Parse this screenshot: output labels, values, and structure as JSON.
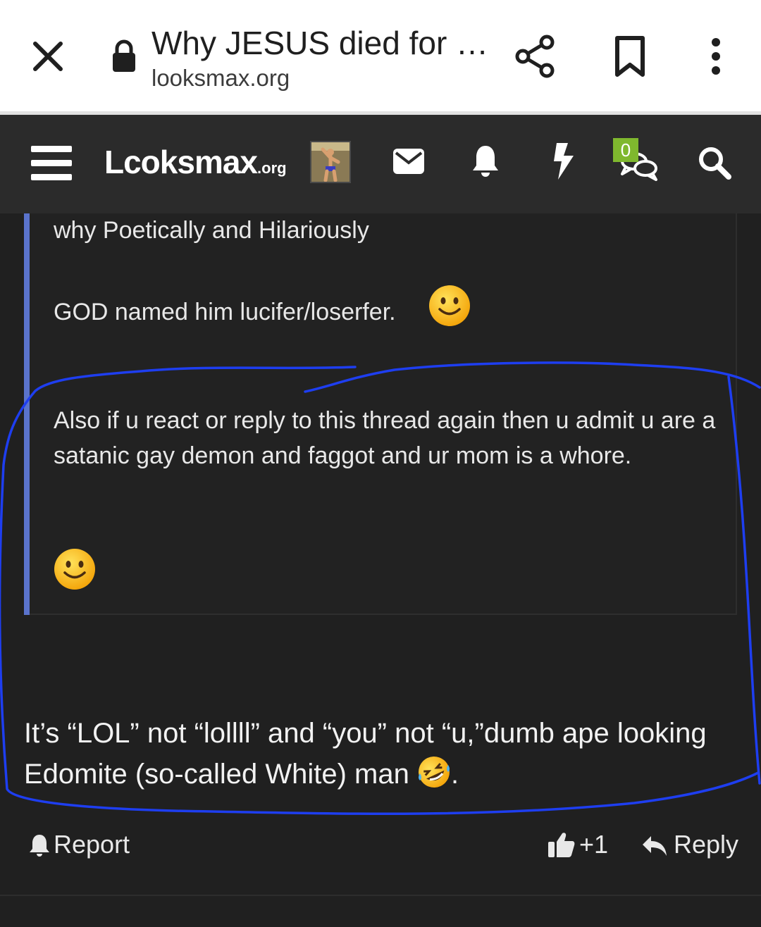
{
  "browser": {
    "title": "Why JESUS died for …",
    "url": "looksmax.org",
    "icons": [
      "close-icon",
      "lock-icon",
      "share-icon",
      "bookmark-icon",
      "more-vert-icon"
    ]
  },
  "nav": {
    "logo_main": "Lcoksmax",
    "logo_tld": ".org",
    "conversations_badge": "0",
    "icons": [
      "menu-icon",
      "inbox-icon",
      "bell-icon",
      "bolt-icon",
      "conversations-icon",
      "search-icon"
    ]
  },
  "quote": {
    "line1": "why Poetically and Hilariously",
    "line2": "GOD named him lucifer/loserfer.",
    "line3": "Also if u react or reply to this thread again then u admit u are a satanic gay demon and faggot and ur mom is a whore."
  },
  "post": {
    "text": "It’s “LOL” not “lollll” and “you” not “u,”dumb ape looking Edomite (so-called White) man",
    "trailing": "."
  },
  "actions": {
    "report": "Report",
    "reaction_count": "+1",
    "reply": "Reply"
  },
  "colors": {
    "background": "#202020",
    "nav_bar": "#2b2b2b",
    "quote_accent": "#5a73cc",
    "badge": "#7fb82e",
    "annotation_stroke": "#1e3ef0"
  }
}
